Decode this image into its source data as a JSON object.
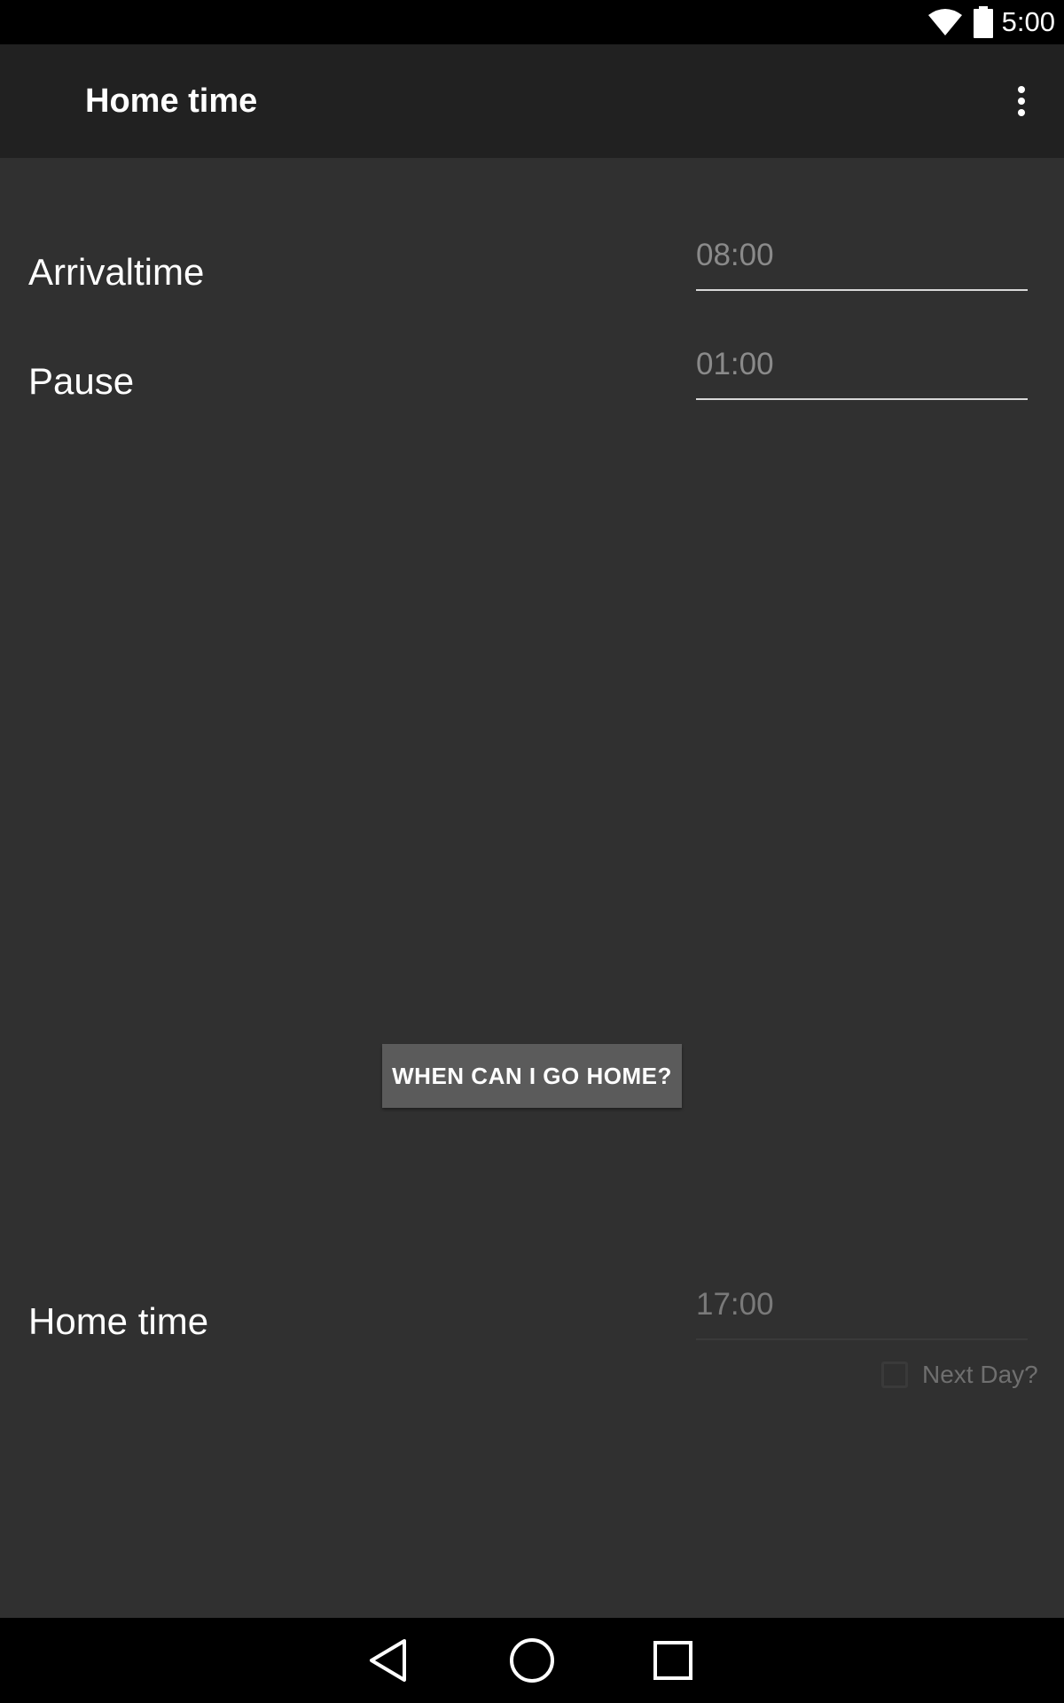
{
  "status_bar": {
    "time": "5:00",
    "icons": [
      "wifi-icon",
      "battery-icon"
    ]
  },
  "app_bar": {
    "title": "Home time",
    "overflow_icon": "more-vert-icon"
  },
  "form": {
    "arrival": {
      "label": "Arrivaltime",
      "value": "08:00"
    },
    "pause": {
      "label": "Pause",
      "value": "01:00"
    },
    "action_button": "WHEN CAN I GO HOME?",
    "home_time": {
      "label": "Home time",
      "value": "17:00"
    },
    "next_day": {
      "label": "Next Day?",
      "checked": false
    }
  },
  "nav_bar": {
    "icons": [
      "back-icon",
      "home-icon",
      "recents-icon"
    ]
  },
  "colors": {
    "background": "#303030",
    "app_bar": "#212121",
    "status_bar": "#000000",
    "button": "#5b5b5b",
    "text": "#ffffff",
    "hint_text": "#8a8a8a"
  }
}
